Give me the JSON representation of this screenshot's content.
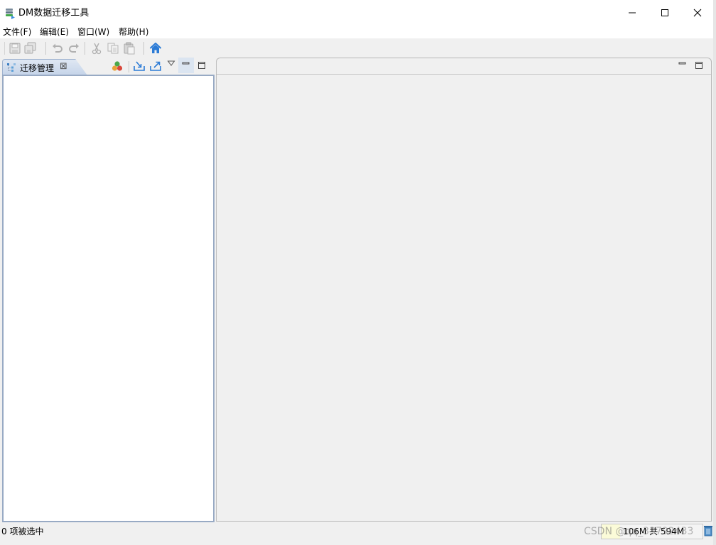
{
  "window": {
    "title": "DM数据迁移工具",
    "controls": {
      "minimize": "minimize",
      "maximize": "maximize",
      "close": "close"
    }
  },
  "menu": [
    {
      "label": "文件(F)"
    },
    {
      "label": "编辑(E)"
    },
    {
      "label": "窗口(W)"
    },
    {
      "label": "帮助(H)"
    }
  ],
  "toolbar": {
    "icons": [
      "save-icon",
      "save-all-icon",
      "undo-icon",
      "redo-icon",
      "cut-icon",
      "copy-icon",
      "paste-icon",
      "home-icon"
    ]
  },
  "left_view": {
    "tab_label": "迁移管理",
    "tab_close": "⊠"
  },
  "status": {
    "selection_text": "0 项被选中",
    "memory": "106M 共 594M",
    "memory_used_fraction": 0.18
  },
  "watermark": "CSDN @qq_33792433",
  "colors": {
    "accent_blue": "#2b7bd6",
    "tab_active_bg": "#c5d4e9",
    "panel_border": "#98aac4"
  }
}
